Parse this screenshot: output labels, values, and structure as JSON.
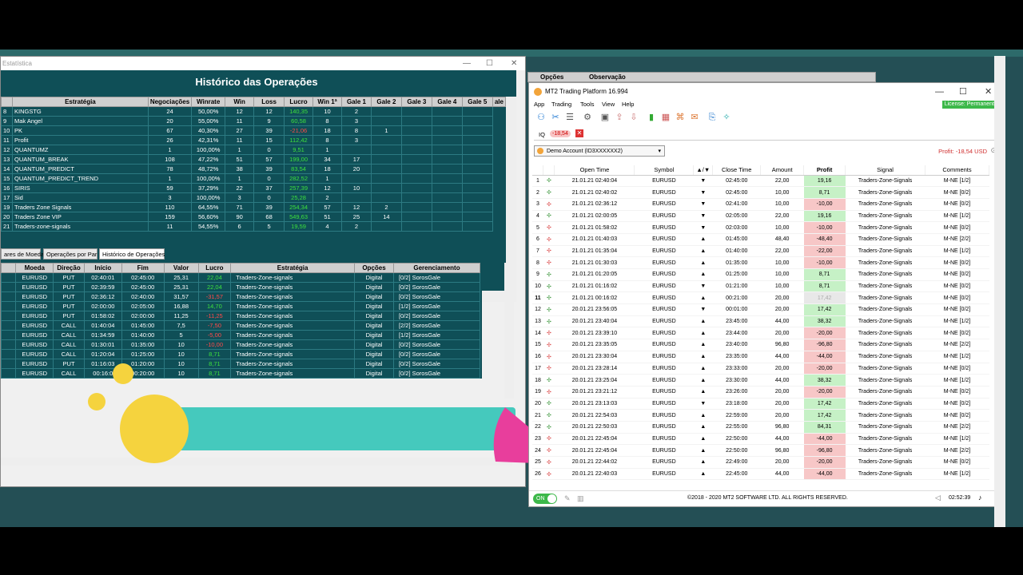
{
  "stat": {
    "window_title": "Estatística",
    "title": "Histórico das Operações",
    "headers": [
      "Estratégia",
      "Negociações",
      "Winrate",
      "Win",
      "Loss",
      "Lucro",
      "Win 1ª",
      "Gale 1",
      "Gale 2",
      "Gale 3",
      "Gale 4",
      "Gale 5",
      "ale"
    ],
    "rows": [
      [
        "8",
        "KINGSTG",
        "24",
        "50,00%",
        "12",
        "12",
        "140,35",
        "10",
        "2",
        "",
        ""
      ],
      [
        "9",
        "Mak Angel",
        "20",
        "55,00%",
        "11",
        "9",
        "60,58",
        "8",
        "3",
        "",
        ""
      ],
      [
        "10",
        "PK",
        "67",
        "40,30%",
        "27",
        "39",
        "-21,06",
        "18",
        "8",
        "1",
        ""
      ],
      [
        "11",
        "Profit",
        "26",
        "42,31%",
        "11",
        "15",
        "112,42",
        "8",
        "3",
        "",
        ""
      ],
      [
        "12",
        "QUANTUMZ",
        "1",
        "100,00%",
        "1",
        "0",
        "9,51",
        "1",
        "",
        "",
        ""
      ],
      [
        "13",
        "QUANTUM_BREAK",
        "108",
        "47,22%",
        "51",
        "57",
        "199,00",
        "34",
        "17",
        "",
        ""
      ],
      [
        "14",
        "QUANTUM_PREDICT",
        "78",
        "48,72%",
        "38",
        "39",
        "83,54",
        "18",
        "20",
        "",
        ""
      ],
      [
        "15",
        "QUANTUM_PREDICT_TREND",
        "1",
        "100,00%",
        "1",
        "0",
        "282,52",
        "1",
        "",
        "",
        ""
      ],
      [
        "16",
        "SIRIS",
        "59",
        "37,29%",
        "22",
        "37",
        "257,39",
        "12",
        "10",
        "",
        ""
      ],
      [
        "17",
        "Sid",
        "3",
        "100,00%",
        "3",
        "0",
        "25,28",
        "2",
        "",
        "",
        ""
      ],
      [
        "19",
        "Traders Zone Signals",
        "110",
        "64,55%",
        "71",
        "39",
        "254,34",
        "57",
        "12",
        "2",
        ""
      ],
      [
        "20",
        "Traders Zone VIP",
        "159",
        "56,60%",
        "90",
        "68",
        "549,63",
        "51",
        "25",
        "14",
        ""
      ],
      [
        "21",
        "Traders-zone-signals",
        "11",
        "54,55%",
        "6",
        "5",
        "19,59",
        "4",
        "2",
        "",
        ""
      ]
    ],
    "tabs": [
      "ares de Moeda",
      "Operações por Par",
      "Histórico de Operações"
    ],
    "ops_headers": [
      "Moeda",
      "Direção",
      "Início",
      "Fim",
      "Valor",
      "Lucro",
      "Estratégia",
      "Opções",
      "Gerenciamento"
    ],
    "ops": [
      [
        "EURUSD",
        "PUT",
        "02:40:01",
        "02:45:00",
        "25,31",
        "22,04",
        "Traders-Zone-signals",
        "Digital",
        "[0/2] SorosGale"
      ],
      [
        "EURUSD",
        "PUT",
        "02:39:59",
        "02:45:00",
        "25,31",
        "22,04",
        "Traders-Zone-signals",
        "Digital",
        "[0/2] SorosGale"
      ],
      [
        "EURUSD",
        "PUT",
        "02:36:12",
        "02:40:00",
        "31,57",
        "-31,57",
        "Traders-Zone-signals",
        "Digital",
        "[0/2] SorosGale"
      ],
      [
        "EURUSD",
        "PUT",
        "02:00:00",
        "02:05:00",
        "16,88",
        "14,70",
        "Traders-Zone-signals",
        "Digital",
        "[1/2] SorosGale"
      ],
      [
        "EURUSD",
        "PUT",
        "01:58:02",
        "02:00:00",
        "11,25",
        "-11,25",
        "Traders-Zone-signals",
        "Digital",
        "[0/2] SorosGale"
      ],
      [
        "EURUSD",
        "CALL",
        "01:40:04",
        "01:45:00",
        "7,5",
        "-7,50",
        "Traders-Zone-signals",
        "Digital",
        "[2/2] SorosGale"
      ],
      [
        "EURUSD",
        "CALL",
        "01:34:59",
        "01:40:00",
        "5",
        "-5,00",
        "Traders-Zone-signals",
        "Digital",
        "[1/2] SorosGale"
      ],
      [
        "EURUSD",
        "CALL",
        "01:30:01",
        "01:35:00",
        "10",
        "-10,00",
        "Traders-Zone-signals",
        "Digital",
        "[0/2] SorosGale"
      ],
      [
        "EURUSD",
        "CALL",
        "01:20:04",
        "01:25:00",
        "10",
        "8,71",
        "Traders-Zone-signals",
        "Digital",
        "[0/2] SorosGale"
      ],
      [
        "EURUSD",
        "PUT",
        "01:16:03",
        "01:20:00",
        "10",
        "8,71",
        "Traders-Zone-signals",
        "Digital",
        "[0/2] SorosGale"
      ],
      [
        "EURUSD",
        "CALL",
        "00:16:0",
        "00:20:00",
        "10",
        "8,71",
        "Traders-Zone-signals",
        "Digital",
        "[0/2] SorosGale"
      ]
    ]
  },
  "opts": {
    "a": "Opções",
    "b": "Observação"
  },
  "mt2": {
    "title": "MT2 Trading Platform 16.994",
    "menu": [
      "App",
      "Trading",
      "Tools",
      "View",
      "Help"
    ],
    "license": "License: Permanent",
    "tab": "IQ",
    "pill": "-18,54",
    "account": "Demo Account (ID3XXXXXX2)",
    "profit": "Profit: -18,54 USD",
    "headers": [
      "Open Time",
      "Symbol",
      "Close Time",
      "Amount",
      "Profit",
      "Signal",
      "Comments"
    ],
    "rows": [
      [
        "1",
        "21.01.21 02:40:04",
        "EURUSD",
        "▼",
        "02:45:00",
        "22,00",
        "19,16",
        "Traders-Zone-Signals",
        "M-NE [1/2]",
        "pos"
      ],
      [
        "2",
        "21.01.21 02:40:02",
        "EURUSD",
        "▼",
        "02:45:00",
        "10,00",
        "8,71",
        "Traders-Zone-Signals",
        "M-NE [0/2]",
        "pos"
      ],
      [
        "3",
        "21.01.21 02:36:12",
        "EURUSD",
        "▼",
        "02:41:00",
        "10,00",
        "-10,00",
        "Traders-Zone-Signals",
        "M-NE [0/2]",
        "neg"
      ],
      [
        "4",
        "21.01.21 02:00:05",
        "EURUSD",
        "▼",
        "02:05:00",
        "22,00",
        "19,16",
        "Traders-Zone-Signals",
        "M-NE [1/2]",
        "pos"
      ],
      [
        "5",
        "21.01.21 01:58:02",
        "EURUSD",
        "▼",
        "02:03:00",
        "10,00",
        "-10,00",
        "Traders-Zone-Signals",
        "M-NE [0/2]",
        "neg"
      ],
      [
        "6",
        "21.01.21 01:40:03",
        "EURUSD",
        "▲",
        "01:45:00",
        "48,40",
        "-48,40",
        "Traders-Zone-Signals",
        "M-NE [2/2]",
        "neg"
      ],
      [
        "7",
        "21.01.21 01:35:04",
        "EURUSD",
        "▲",
        "01:40:00",
        "22,00",
        "-22,00",
        "Traders-Zone-Signals",
        "M-NE [1/2]",
        "neg"
      ],
      [
        "8",
        "21.01.21 01:30:03",
        "EURUSD",
        "▲",
        "01:35:00",
        "10,00",
        "-10,00",
        "Traders-Zone-Signals",
        "M-NE [0/2]",
        "neg"
      ],
      [
        "9",
        "21.01.21 01:20:05",
        "EURUSD",
        "▲",
        "01:25:00",
        "10,00",
        "8,71",
        "Traders-Zone-Signals",
        "M-NE [0/2]",
        "pos"
      ],
      [
        "10",
        "21.01.21 01:16:02",
        "EURUSD",
        "▼",
        "01:21:00",
        "10,00",
        "8,71",
        "Traders-Zone-Signals",
        "M-NE [0/2]",
        "pos"
      ],
      [
        "11",
        "21.01.21 00:16:02",
        "EURUSD",
        "▲",
        "00:21:00",
        "20,00",
        "17,42",
        "Traders-Zone-Signals",
        "M-NE [0/2]",
        "gry"
      ],
      [
        "12",
        "20.01.21 23:56:05",
        "EURUSD",
        "▼",
        "00:01:00",
        "20,00",
        "17,42",
        "Traders-Zone-Signals",
        "M-NE [0/2]",
        "pos"
      ],
      [
        "13",
        "20.01.21 23:40:04",
        "EURUSD",
        "▲",
        "23:45:00",
        "44,00",
        "38,32",
        "Traders-Zone-Signals",
        "M-NE [1/2]",
        "pos"
      ],
      [
        "14",
        "20.01.21 23:39:10",
        "EURUSD",
        "▲",
        "23:44:00",
        "20,00",
        "-20,00",
        "Traders-Zone-Signals",
        "M-NE [0/2]",
        "neg"
      ],
      [
        "15",
        "20.01.21 23:35:05",
        "EURUSD",
        "▲",
        "23:40:00",
        "96,80",
        "-96,80",
        "Traders-Zone-Signals",
        "M-NE [2/2]",
        "neg"
      ],
      [
        "16",
        "20.01.21 23:30:04",
        "EURUSD",
        "▲",
        "23:35:00",
        "44,00",
        "-44,00",
        "Traders-Zone-Signals",
        "M-NE [1/2]",
        "neg"
      ],
      [
        "17",
        "20.01.21 23:28:14",
        "EURUSD",
        "▲",
        "23:33:00",
        "20,00",
        "-20,00",
        "Traders-Zone-Signals",
        "M-NE [0/2]",
        "neg"
      ],
      [
        "18",
        "20.01.21 23:25:04",
        "EURUSD",
        "▲",
        "23:30:00",
        "44,00",
        "38,32",
        "Traders-Zone-Signals",
        "M-NE [1/2]",
        "pos"
      ],
      [
        "19",
        "20.01.21 23:21:12",
        "EURUSD",
        "▲",
        "23:26:00",
        "20,00",
        "-20,00",
        "Traders-Zone-Signals",
        "M-NE [0/2]",
        "neg"
      ],
      [
        "20",
        "20.01.21 23:13:03",
        "EURUSD",
        "▼",
        "23:18:00",
        "20,00",
        "17,42",
        "Traders-Zone-Signals",
        "M-NE [0/2]",
        "pos"
      ],
      [
        "21",
        "20.01.21 22:54:03",
        "EURUSD",
        "▲",
        "22:59:00",
        "20,00",
        "17,42",
        "Traders-Zone-Signals",
        "M-NE [0/2]",
        "pos"
      ],
      [
        "22",
        "20.01.21 22:50:03",
        "EURUSD",
        "▲",
        "22:55:00",
        "96,80",
        "84,31",
        "Traders-Zone-Signals",
        "M-NE [2/2]",
        "pos"
      ],
      [
        "23",
        "20.01.21 22:45:04",
        "EURUSD",
        "▲",
        "22:50:00",
        "44,00",
        "-44,00",
        "Traders-Zone-Signals",
        "M-NE [1/2]",
        "neg"
      ],
      [
        "24",
        "20.01.21 22:45:04",
        "EURUSD",
        "▲",
        "22:50:00",
        "96,80",
        "-96,80",
        "Traders-Zone-Signals",
        "M-NE [2/2]",
        "neg"
      ],
      [
        "25",
        "20.01.21 22:44:02",
        "EURUSD",
        "▲",
        "22:49:00",
        "20,00",
        "-20,00",
        "Traders-Zone-Signals",
        "M-NE [0/2]",
        "neg"
      ],
      [
        "26",
        "20.01.21 22:40:03",
        "EURUSD",
        "▲",
        "22:45:00",
        "44,00",
        "-44,00",
        "Traders-Zone-Signals",
        "M-NE [1/2]",
        "neg"
      ]
    ],
    "copyright": "©2018 - 2020 MT2 SOFTWARE LTD. ALL RIGHTS RESERVED.",
    "toggle": "ON",
    "clock": "02:52:39"
  }
}
